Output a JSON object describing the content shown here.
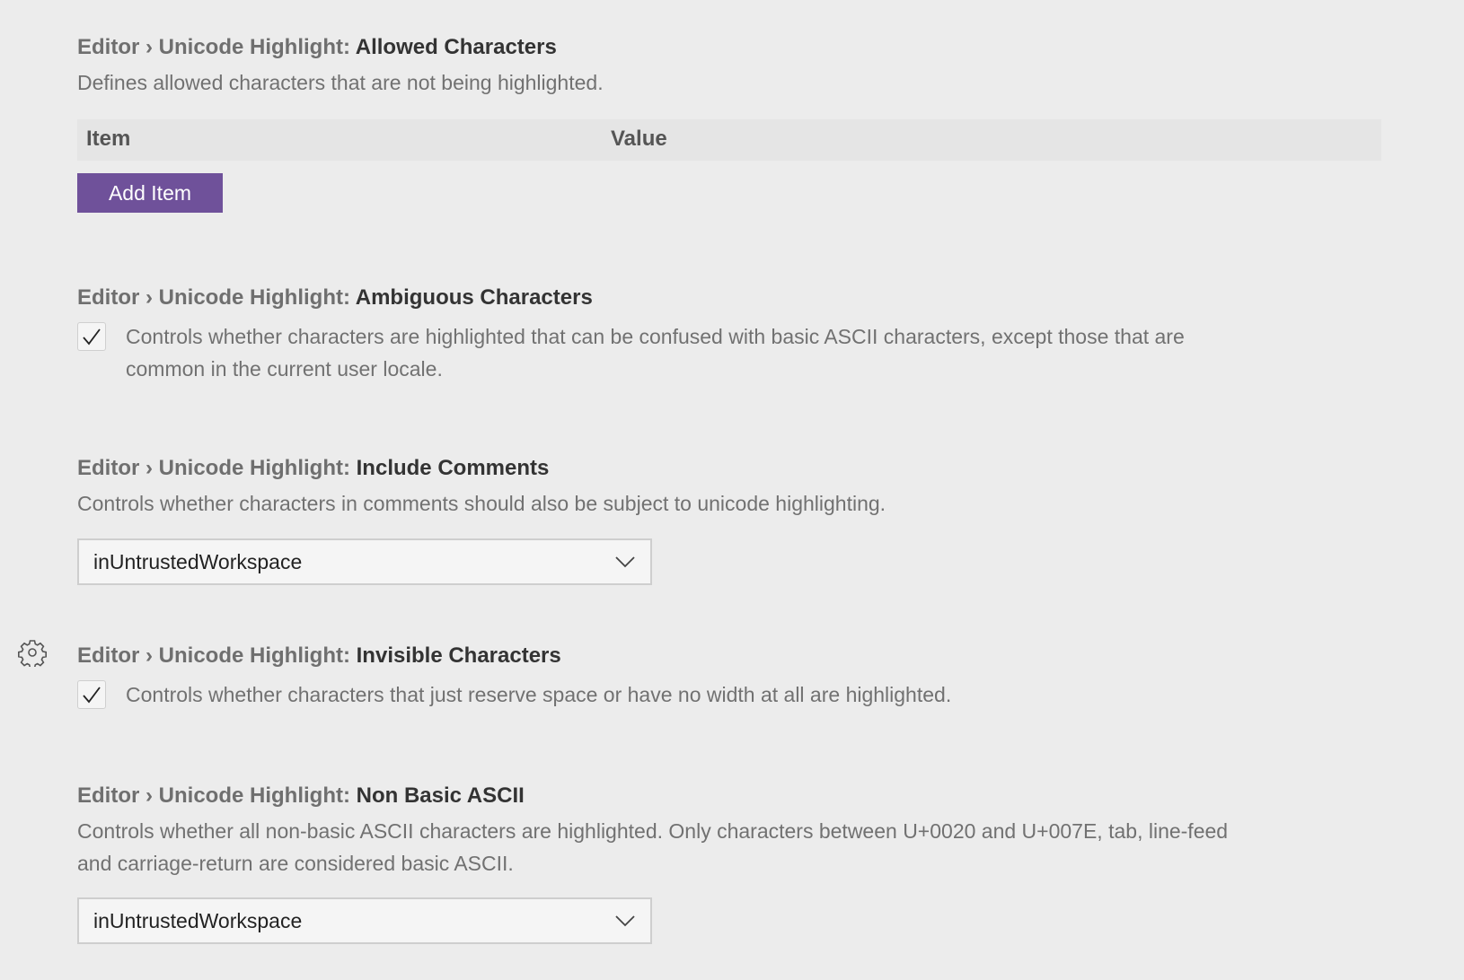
{
  "settings": [
    {
      "category": "Editor › Unicode Highlight: ",
      "name": "Allowed Characters",
      "description": "Defines allowed characters that are not being highlighted.",
      "type": "list",
      "list_header": {
        "item": "Item",
        "value": "Value"
      },
      "add_button": "Add Item"
    },
    {
      "category": "Editor › Unicode Highlight: ",
      "name": "Ambiguous Characters",
      "type": "checkbox",
      "checked": true,
      "description_line1": "Controls whether characters are highlighted that can be confused with basic ASCII characters, except those that are",
      "description_line2": "common in the current user locale."
    },
    {
      "category": "Editor › Unicode Highlight: ",
      "name": "Include Comments",
      "description": "Controls whether characters in comments should also be subject to unicode highlighting.",
      "type": "select",
      "selected": "inUntrustedWorkspace"
    },
    {
      "category": "Editor › Unicode Highlight: ",
      "name": "Invisible Characters",
      "type": "checkbox",
      "checked": true,
      "description": "Controls whether characters that just reserve space or have no width at all are highlighted.",
      "gear_icon": "gear-icon"
    },
    {
      "category": "Editor › Unicode Highlight: ",
      "name": "Non Basic ASCII",
      "description_line1": "Controls whether all non-basic ASCII characters are highlighted. Only characters between U+0020 and U+007E, tab, line-feed",
      "description_line2": "and carriage-return are considered basic ASCII.",
      "type": "select",
      "selected": "inUntrustedWorkspace"
    }
  ],
  "colors": {
    "background": "#ececec",
    "button": "#6f519a",
    "list_header_bg": "#e5e5e5"
  }
}
